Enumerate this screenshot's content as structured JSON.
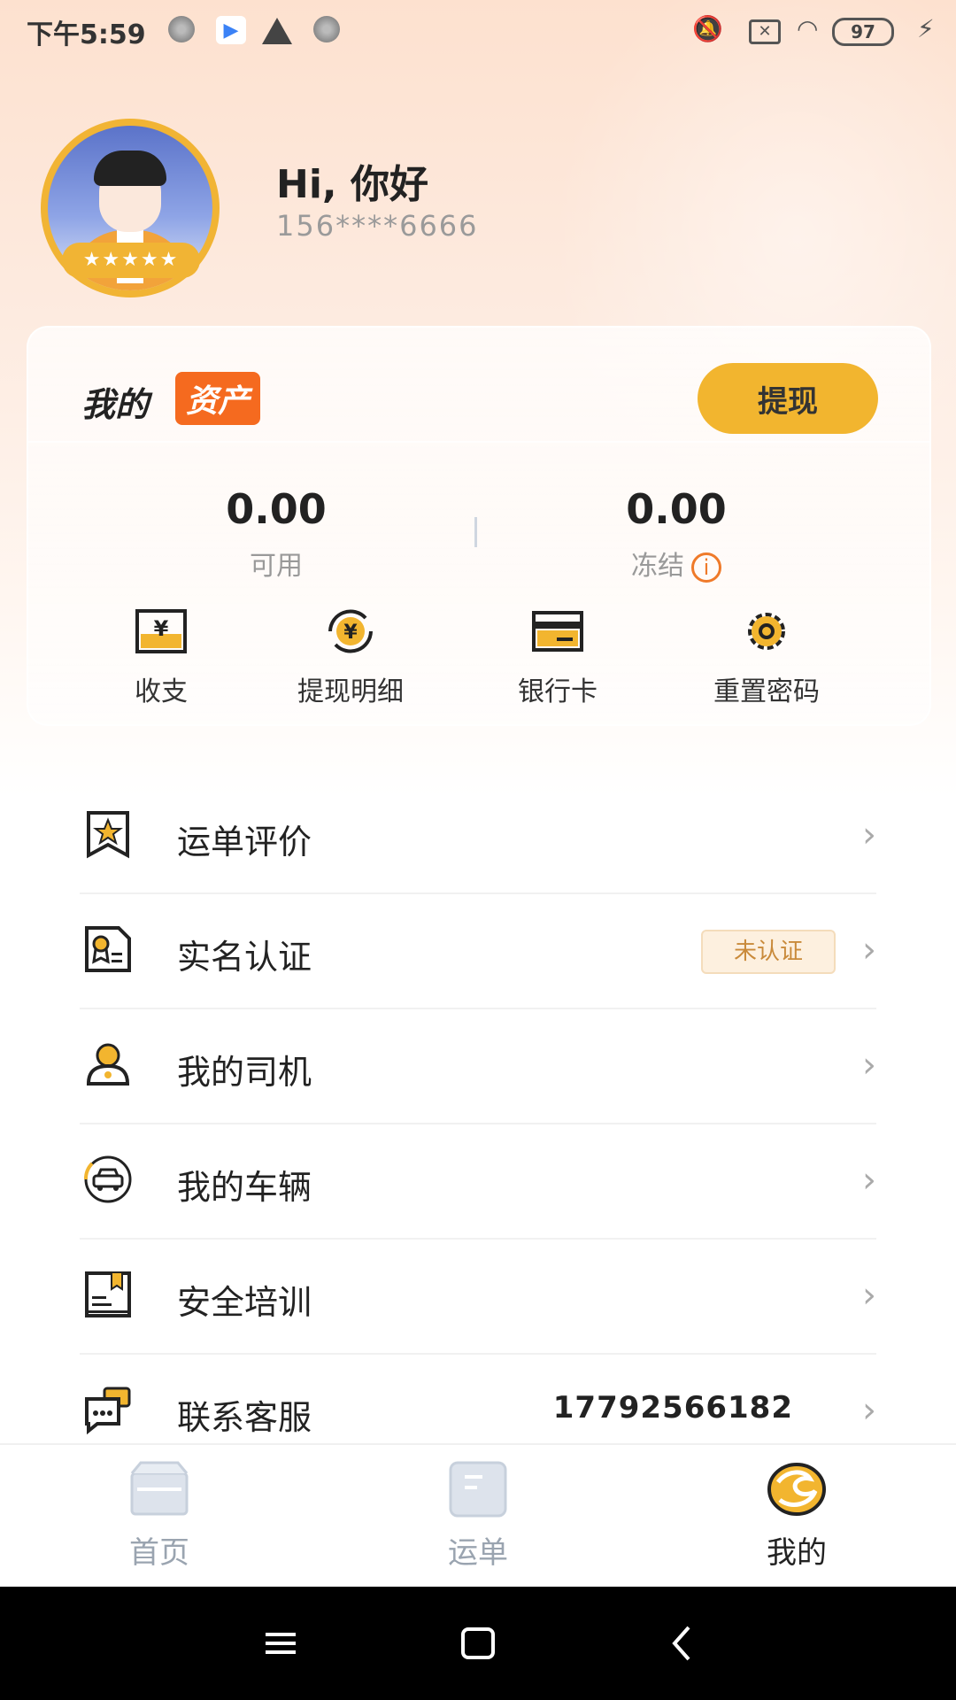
{
  "status_bar": {
    "time": "下午5:59",
    "battery": "97"
  },
  "profile": {
    "greeting": "Hi, 你好",
    "phone": "156****6666",
    "rating_stars": "★★★★★"
  },
  "assets": {
    "title_plain": "我的",
    "title_highlight": "资产",
    "withdraw_label": "提现",
    "available_amount": "0.00",
    "available_label": "可用",
    "frozen_amount": "0.00",
    "frozen_label": "冻结",
    "quick_actions": [
      {
        "label": "收支",
        "icon": "income-expense-icon"
      },
      {
        "label": "提现明细",
        "icon": "withdraw-detail-icon"
      },
      {
        "label": "银行卡",
        "icon": "bank-card-icon"
      },
      {
        "label": "重置密码",
        "icon": "gear-icon"
      }
    ]
  },
  "menu": [
    {
      "label": "运单评价",
      "icon": "star-bookmark-icon"
    },
    {
      "label": "实名认证",
      "icon": "id-certificate-icon",
      "tag": "未认证"
    },
    {
      "label": "我的司机",
      "icon": "driver-icon"
    },
    {
      "label": "我的车辆",
      "icon": "car-icon"
    },
    {
      "label": "安全培训",
      "icon": "book-icon"
    },
    {
      "label": "联系客服",
      "icon": "chat-icon",
      "value": "17792566182"
    }
  ],
  "tabs": [
    {
      "label": "首页",
      "icon": "box-icon",
      "active": false
    },
    {
      "label": "运单",
      "icon": "document-icon",
      "active": false
    },
    {
      "label": "我的",
      "icon": "profile-emblem-icon",
      "active": true
    }
  ],
  "colors": {
    "accent_yellow": "#f2b52f",
    "accent_orange": "#f56a1f",
    "text_dark": "#222222",
    "text_gray": "#999999"
  }
}
